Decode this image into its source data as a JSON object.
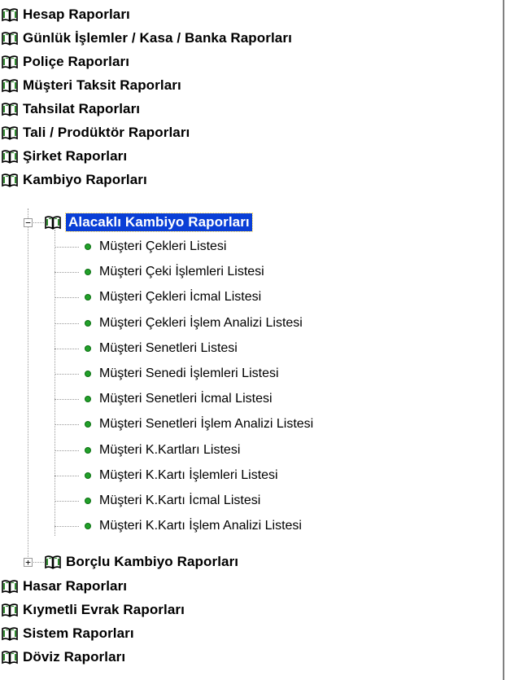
{
  "tree": {
    "roots_top": [
      {
        "label": "Hesap Raporları",
        "icon": "book-icon"
      },
      {
        "label": "Günlük İşlemler / Kasa / Banka Raporları",
        "icon": "book-icon"
      },
      {
        "label": "Poliçe Raporları",
        "icon": "book-icon"
      },
      {
        "label": "Müşteri Taksit Raporları",
        "icon": "book-icon"
      },
      {
        "label": "Tahsilat Raporları",
        "icon": "book-icon"
      },
      {
        "label": "Tali / Prodüktör Raporları",
        "icon": "book-icon"
      },
      {
        "label": "Şirket Raporları",
        "icon": "book-icon"
      },
      {
        "label": "Kambiyo Raporları",
        "icon": "book-icon"
      }
    ],
    "kambiyo_children": {
      "alacakli": {
        "label": "Alacaklı Kambiyo Raporları",
        "expander": "−",
        "selected": true
      },
      "alacakli_items": [
        "Müşteri Çekleri Listesi",
        "Müşteri Çeki İşlemleri Listesi",
        "Müşteri Çekleri İcmal Listesi",
        "Müşteri Çekleri İşlem Analizi Listesi",
        "Müşteri Senetleri Listesi",
        "Müşteri Senedi İşlemleri Listesi",
        "Müşteri Senetleri İcmal Listesi",
        "Müşteri Senetleri İşlem Analizi Listesi",
        "Müşteri K.Kartları Listesi",
        "Müşteri K.Kartı İşlemleri Listesi",
        "Müşteri K.Kartı İcmal Listesi",
        "Müşteri K.Kartı İşlem Analizi Listesi"
      ],
      "borclu": {
        "label": "Borçlu Kambiyo Raporları",
        "expander": "+"
      }
    },
    "roots_bottom": [
      {
        "label": "Hasar Raporları",
        "icon": "book-icon"
      },
      {
        "label": "Kıymetli Evrak Raporları",
        "icon": "book-icon"
      },
      {
        "label": "Sistem Raporları",
        "icon": "book-icon"
      },
      {
        "label": "Döviz Raporları",
        "icon": "book-icon"
      }
    ]
  },
  "colors": {
    "selection": "#0a3fd6",
    "leaf_dot": "#22a02a",
    "book": "#2e8b2e"
  }
}
